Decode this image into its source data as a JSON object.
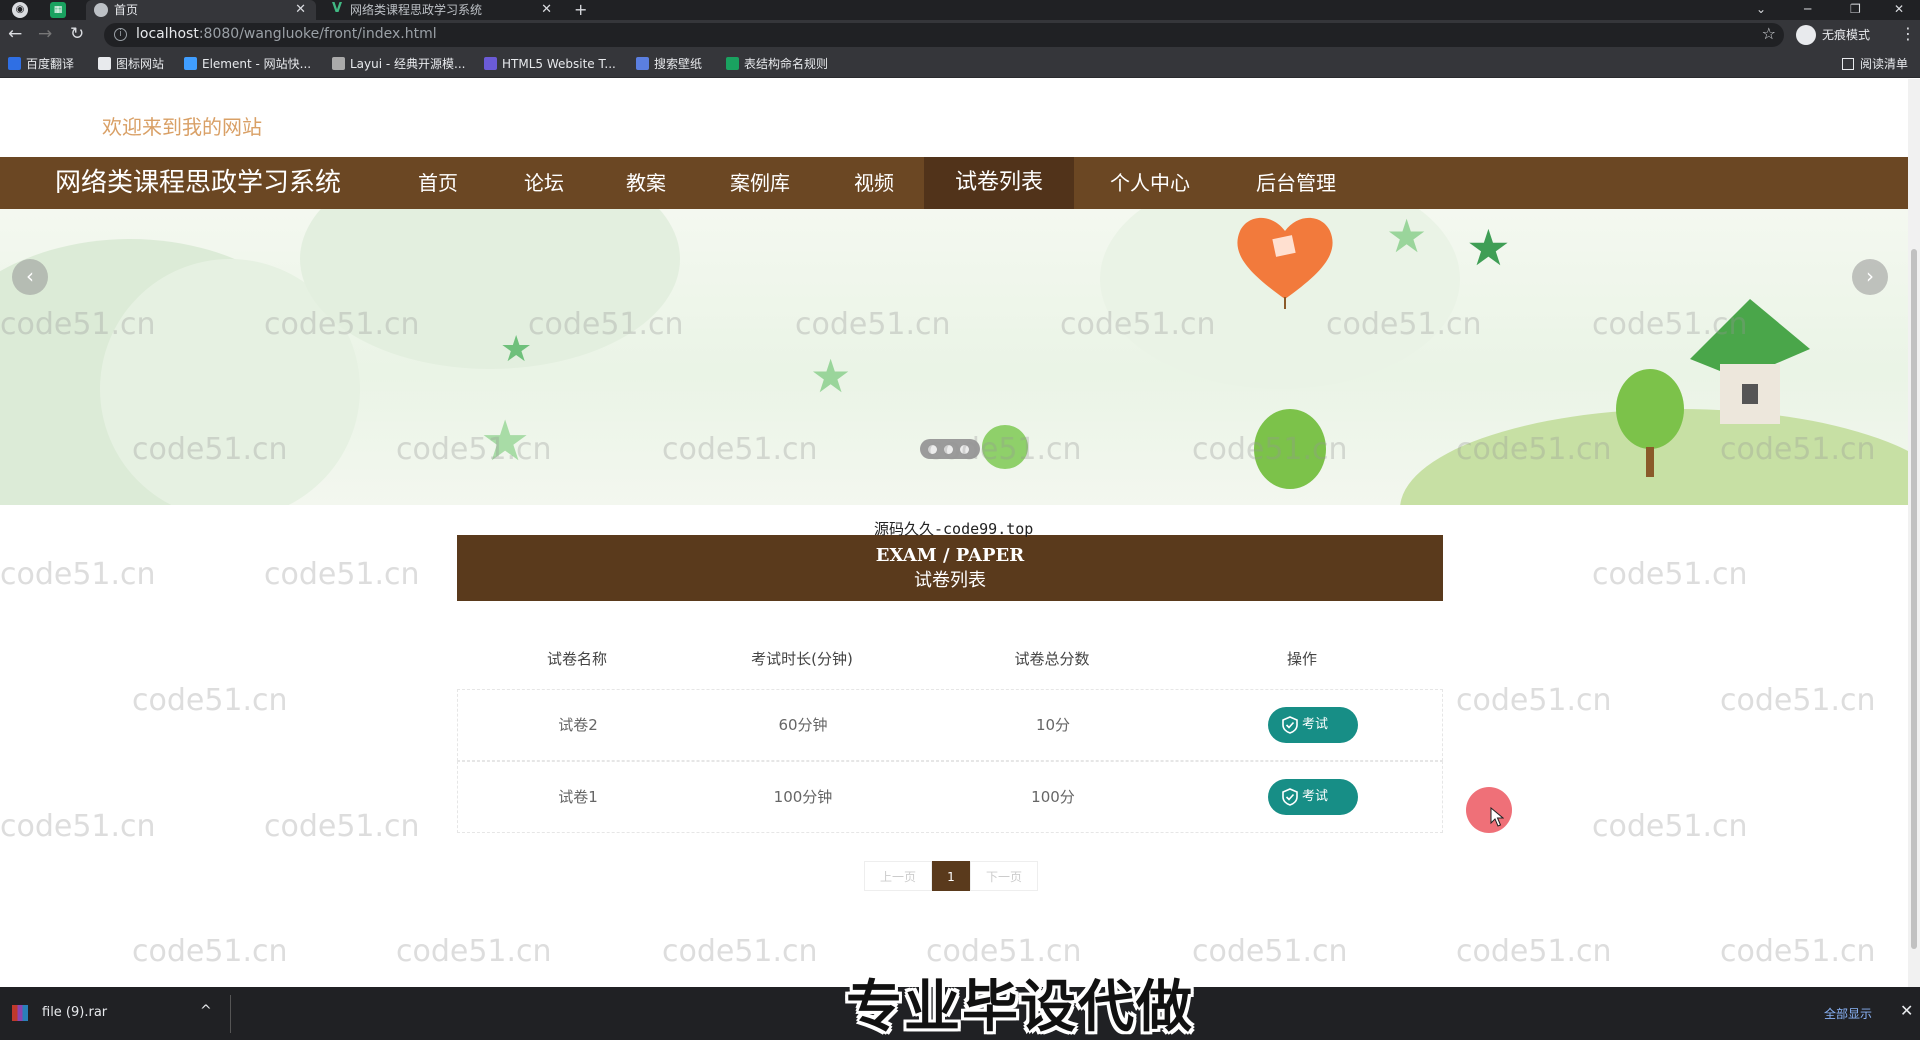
{
  "browser": {
    "tabs": [
      {
        "title": "首页",
        "active": true
      },
      {
        "title": "网络类课程思政学习系统",
        "active": false
      }
    ],
    "url_host": "localhost",
    "url_path": ":8080/wangluoke/front/index.html",
    "incognito_label": "无痕模式",
    "bookmarks": [
      "百度翻译",
      "图标网站",
      "Element - 网站快...",
      "Layui - 经典开源模...",
      "HTML5 Website T...",
      "搜索壁纸",
      "表结构命名规则"
    ],
    "reading_list": "阅读清单"
  },
  "site": {
    "welcome": "欢迎来到我的网站",
    "brand": "网络类课程思政学习系统",
    "nav": [
      "首页",
      "论坛",
      "教案",
      "案例库",
      "视频",
      "试卷列表",
      "个人中心",
      "后台管理"
    ],
    "active_nav": "试卷列表"
  },
  "overlay_text": "源码久久-code99.top",
  "section": {
    "title_en": "EXAM / PAPER",
    "title_cn": "试卷列表"
  },
  "table": {
    "headers": [
      "试卷名称",
      "考试时长(分钟)",
      "试卷总分数",
      "操作"
    ],
    "rows": [
      {
        "name": "试卷2",
        "duration": "60分钟",
        "score": "10分",
        "action": "考试"
      },
      {
        "name": "试卷1",
        "duration": "100分钟",
        "score": "100分",
        "action": "考试"
      }
    ]
  },
  "pagination": {
    "prev": "上一页",
    "current": "1",
    "next": "下一页"
  },
  "watermark": "code51.cn",
  "download_bar": {
    "file": "file (9).rar",
    "show_all": "全部显示"
  },
  "video_caption": "专业毕设代做",
  "colors": {
    "navbar": "#6b4723",
    "nav_active": "#51331a",
    "section_bg": "#5a3a1c",
    "exam_button": "#178e86",
    "welcome_text": "#d9a066"
  }
}
